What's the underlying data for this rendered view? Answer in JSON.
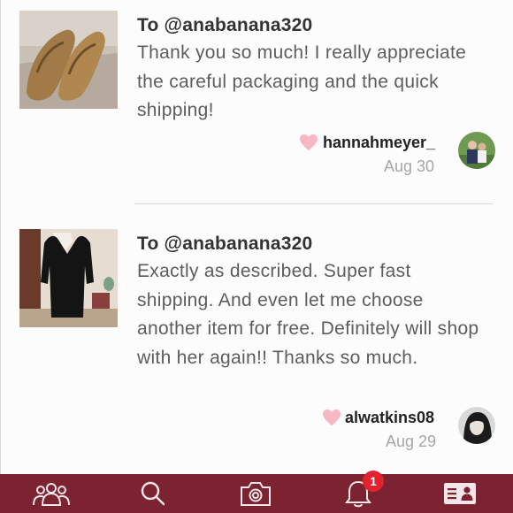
{
  "reviews": [
    {
      "to": "To @anabanana320",
      "text": "Thank you so much! I really appreciate the careful packaging and the quick shipping!",
      "username": "hannahmeyer_",
      "date": "Aug 30",
      "thumbnail": "tan-loafers",
      "avatar": "couple-outdoors"
    },
    {
      "to": "To @anabanana320",
      "text": "Exactly as described. Super fast shipping. And even let me choose another item for free. Definitely will shop with her again!! Thanks so much.",
      "username": "alwatkins08",
      "date": "Aug 29",
      "thumbnail": "black-dress",
      "avatar": "woman-portrait"
    }
  ],
  "tabbar": {
    "background": "#7b2331",
    "tabs": [
      {
        "icon": "people-icon"
      },
      {
        "icon": "search-icon"
      },
      {
        "icon": "camera-icon"
      },
      {
        "icon": "bell-icon",
        "badge": "1"
      },
      {
        "icon": "profile-card-icon"
      }
    ]
  },
  "colors": {
    "heart": "#f7b8c3",
    "badge": "#e2232f"
  }
}
